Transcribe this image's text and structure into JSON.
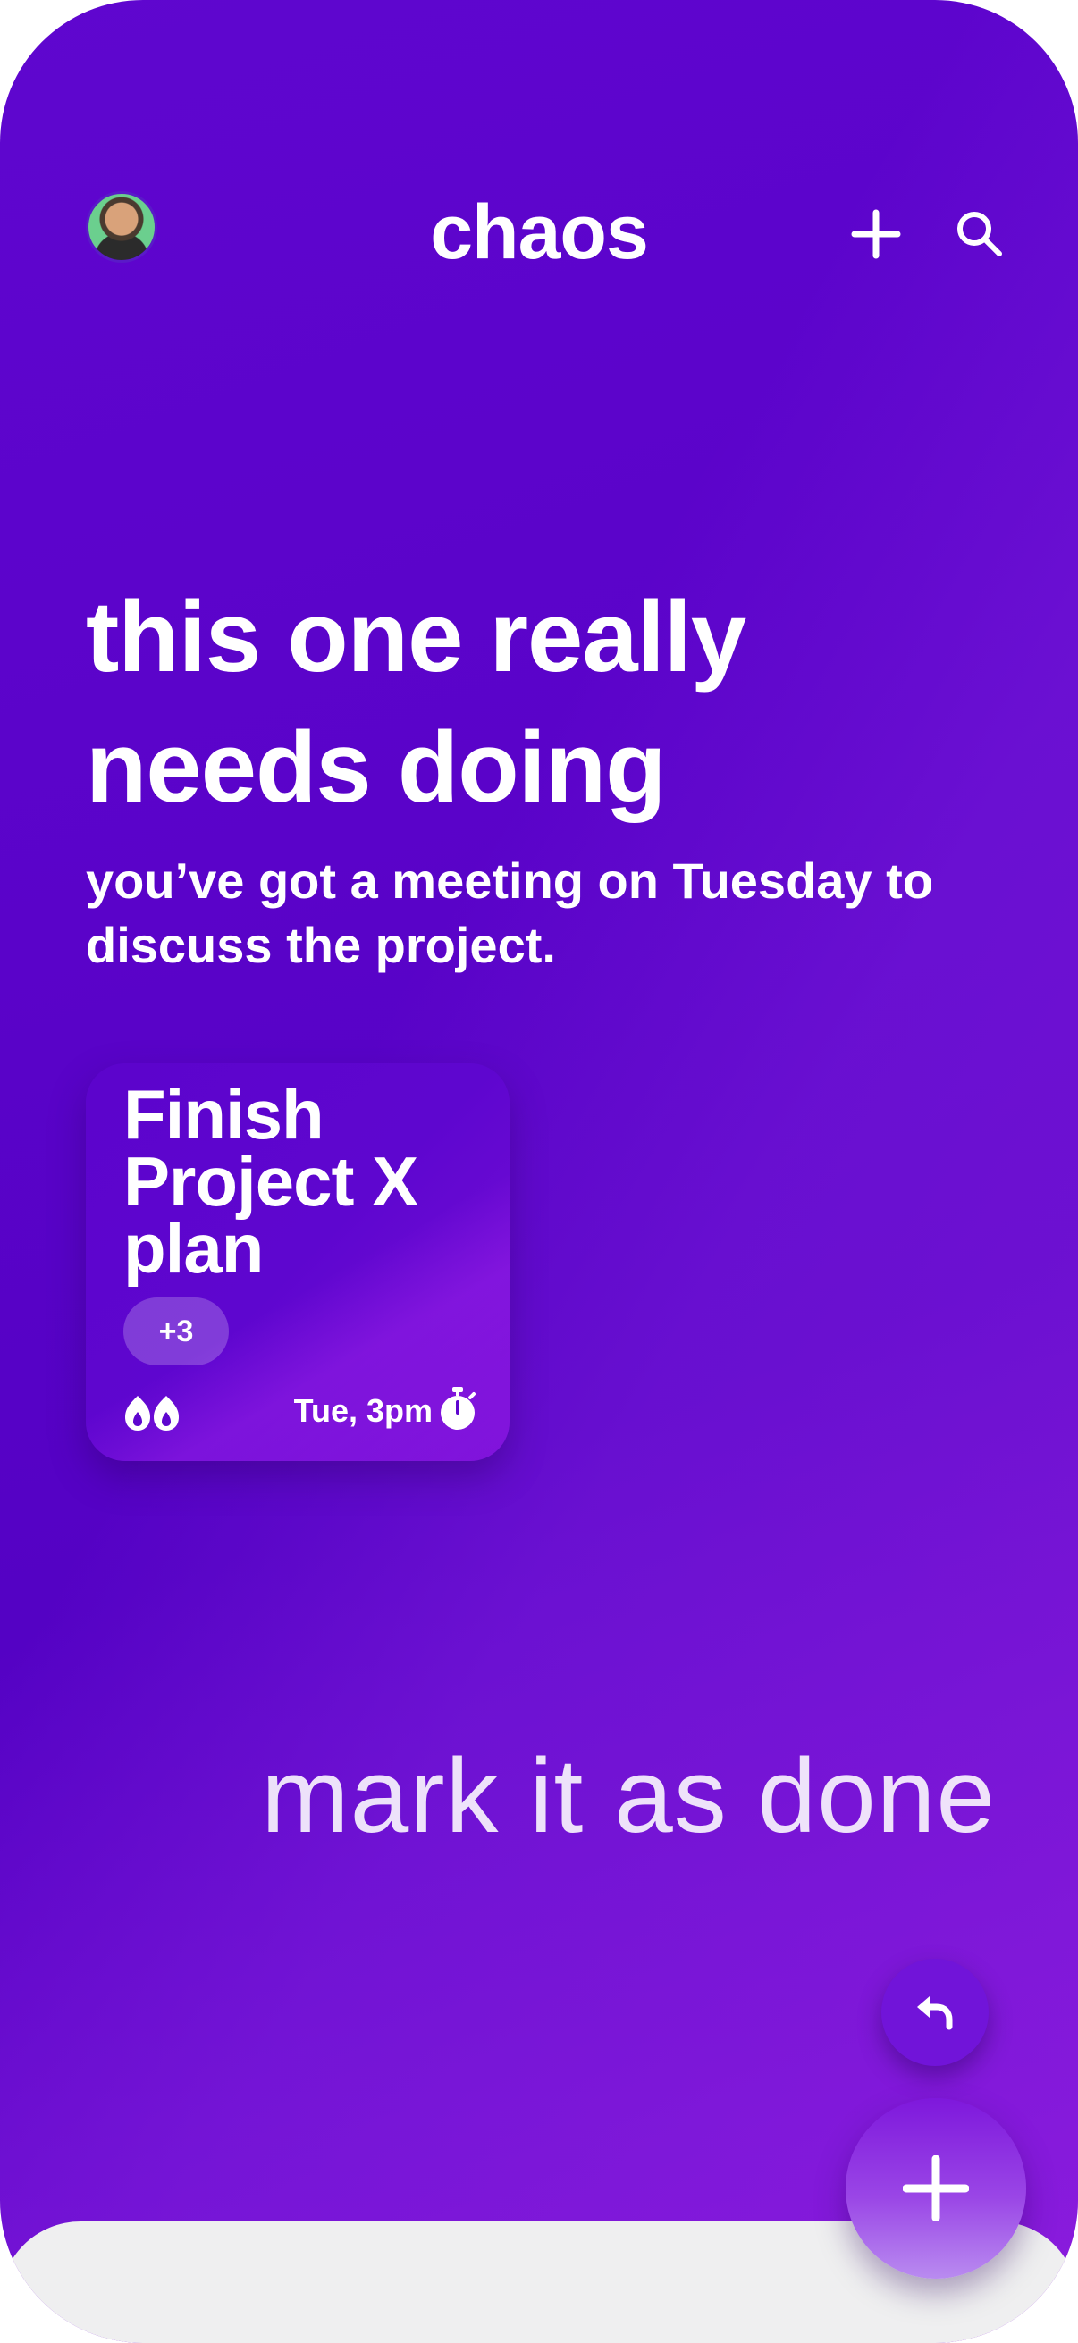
{
  "header": {
    "app_title": "chaos",
    "avatar": "user-avatar",
    "add_icon": "plus-icon",
    "search_icon": "search-icon"
  },
  "prompt": {
    "headline": "this one really needs doing",
    "subline": "you’ve got a meeting on Tuesday to discuss the project."
  },
  "task_card": {
    "title": "Finish Project X plan",
    "badge": "+3",
    "priority_icon": "flame-pair-icon",
    "due": "Tue, 3pm",
    "due_icon": "stopwatch-icon"
  },
  "hint": {
    "text": "mark it as done"
  },
  "actions": {
    "undo_icon": "undo-arrow-icon",
    "fab_icon": "plus-icon"
  },
  "colors": {
    "background": "#5a03c9",
    "accent": "#7114d9",
    "text": "#ffffff",
    "sheet": "#efeff0"
  }
}
